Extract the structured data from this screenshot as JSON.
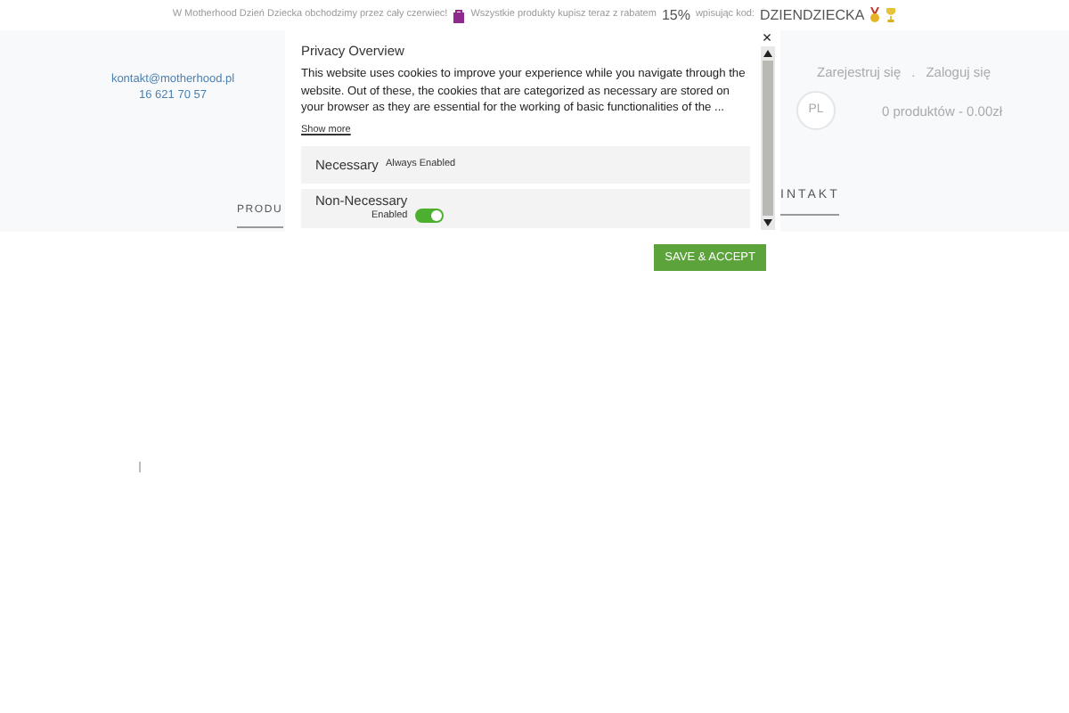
{
  "announcement": {
    "text": "W Motherhood Dzień Dziecka obchodzimy przez cały czerwiec!",
    "promo": "Wszystkie produkty kupisz teraz z rabatem",
    "discount": "15%",
    "code_label": "wpisując kod:",
    "code": "DZIENDZIECKA"
  },
  "contact": {
    "email": "kontakt@motherhood.pl",
    "phone": "16 621 70 57"
  },
  "account_links": [
    "Zarejestruj się",
    ".",
    "Zaloguj się"
  ],
  "language": "PL",
  "cart": "0 produktów - 0.00zł",
  "nav": [
    {
      "label": "PRODU",
      "selected": false
    },
    {
      "label": "INTAKT",
      "selected": false
    }
  ],
  "cookie_dialog": {
    "close": "×",
    "title": "Privacy Overview",
    "body": "This website uses cookies to improve your experience while you navigate through the website. Out of these, the cookies that are categorized as necessary are stored on your browser as they are essential for the working of basic functionalities of the ...",
    "show_more": "Show more",
    "categories": [
      {
        "kind": "always",
        "name": "Necessary",
        "status": "Always Enabled"
      },
      {
        "kind": "toggle",
        "name": "Non-Necessary",
        "status": "Enabled",
        "on": true
      }
    ],
    "save_button": "SAVE & ACCEPT"
  }
}
